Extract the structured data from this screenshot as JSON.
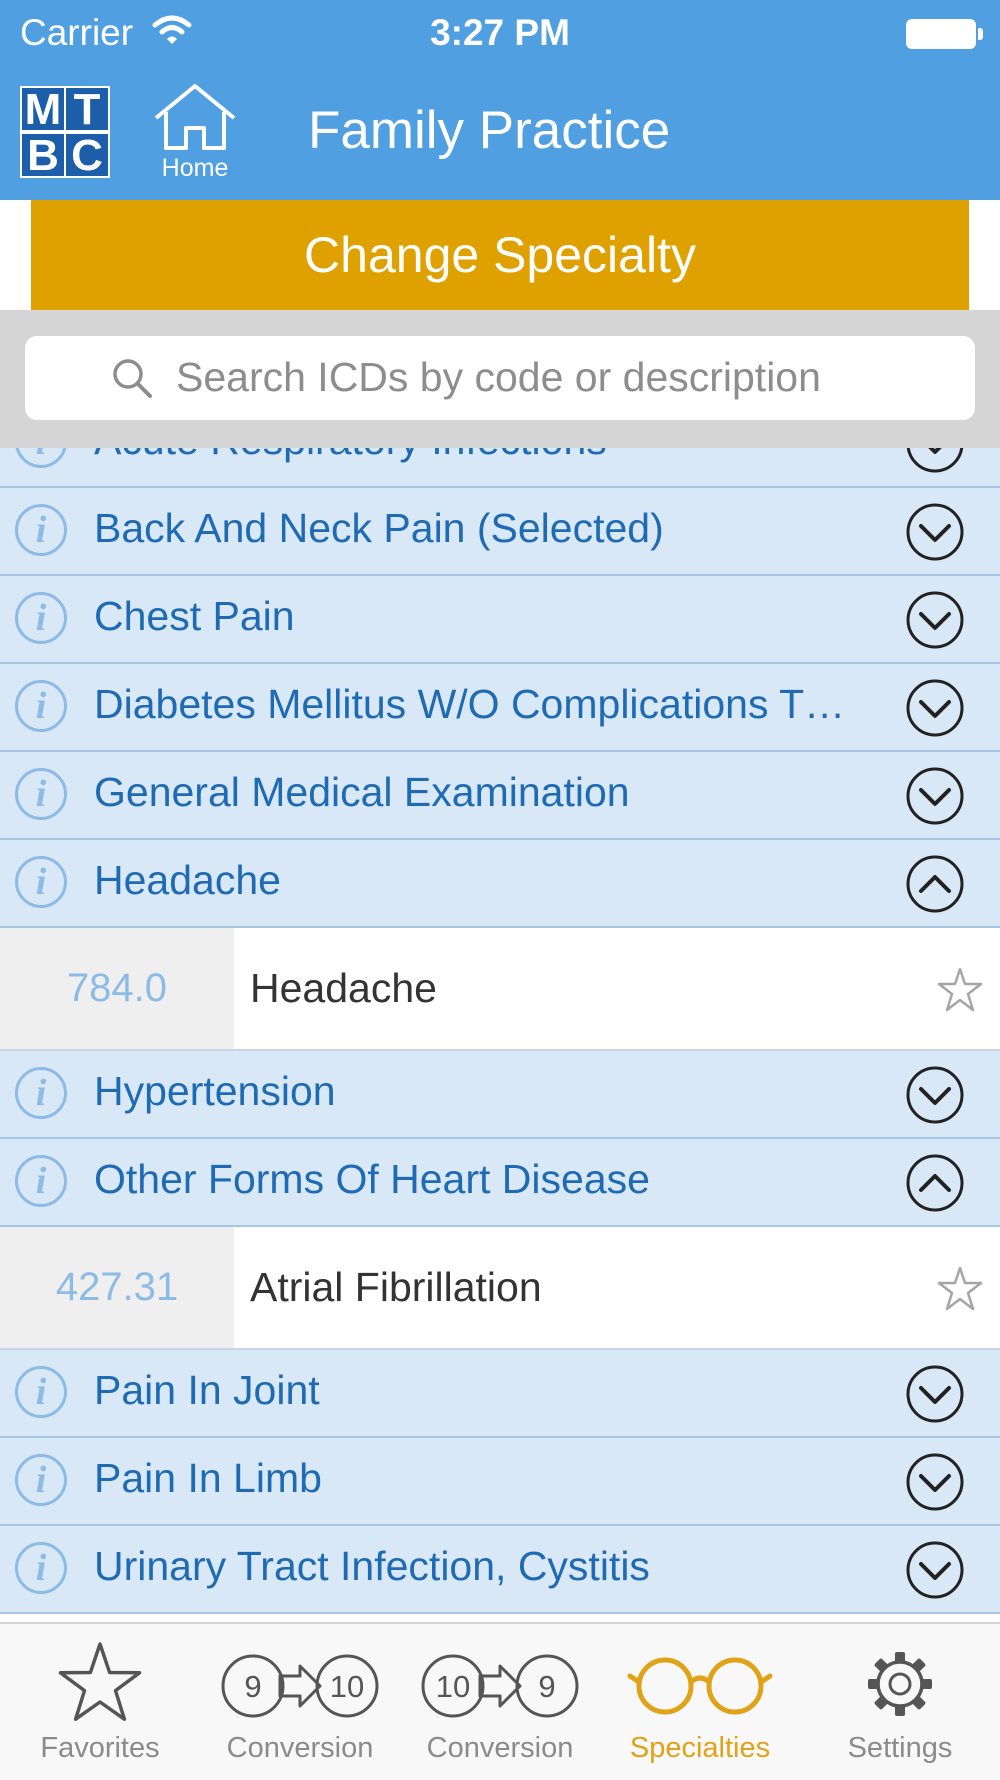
{
  "status_bar": {
    "carrier": "Carrier",
    "time": "3:27 PM"
  },
  "header": {
    "logo_letters": [
      "M",
      "T",
      "B",
      "C"
    ],
    "home_label": "Home",
    "title": "Family Practice"
  },
  "change_specialty_label": "Change Specialty",
  "search": {
    "placeholder": "Search ICDs by code or description"
  },
  "groups": [
    {
      "label": "Acute Respiratory Infections",
      "expanded": false,
      "items": []
    },
    {
      "label": "Back And Neck Pain (Selected)",
      "expanded": false,
      "items": []
    },
    {
      "label": "Chest Pain",
      "expanded": false,
      "items": []
    },
    {
      "label": "Diabetes Mellitus W/O Complications T…",
      "expanded": false,
      "items": []
    },
    {
      "label": "General Medical Examination",
      "expanded": false,
      "items": []
    },
    {
      "label": "Headache",
      "expanded": true,
      "items": [
        {
          "code": "784.0",
          "description": "Headache"
        }
      ]
    },
    {
      "label": "Hypertension",
      "expanded": false,
      "items": []
    },
    {
      "label": "Other Forms Of Heart Disease",
      "expanded": true,
      "items": [
        {
          "code": "427.31",
          "description": "Atrial Fibrillation"
        }
      ]
    },
    {
      "label": "Pain In Joint",
      "expanded": false,
      "items": []
    },
    {
      "label": "Pain In Limb",
      "expanded": false,
      "items": []
    },
    {
      "label": "Urinary Tract Infection, Cystitis",
      "expanded": false,
      "items": []
    }
  ],
  "tabs": [
    {
      "label": "Favorites",
      "icon": "star-icon",
      "active": false
    },
    {
      "label": "Conversion",
      "icon": "icd9-to-icd10-icon",
      "from": "9",
      "to": "10",
      "active": false
    },
    {
      "label": "Conversion",
      "icon": "icd10-to-icd9-icon",
      "from": "10",
      "to": "9",
      "active": false
    },
    {
      "label": "Specialties",
      "icon": "glasses-icon",
      "active": true
    },
    {
      "label": "Settings",
      "icon": "gear-icon",
      "active": false
    }
  ],
  "colors": {
    "header": "#4f9fe1",
    "accent": "#dfa100",
    "group_background": "#d9e8f6",
    "group_text": "#1f6bb3",
    "active_tab": "#e0a216"
  }
}
